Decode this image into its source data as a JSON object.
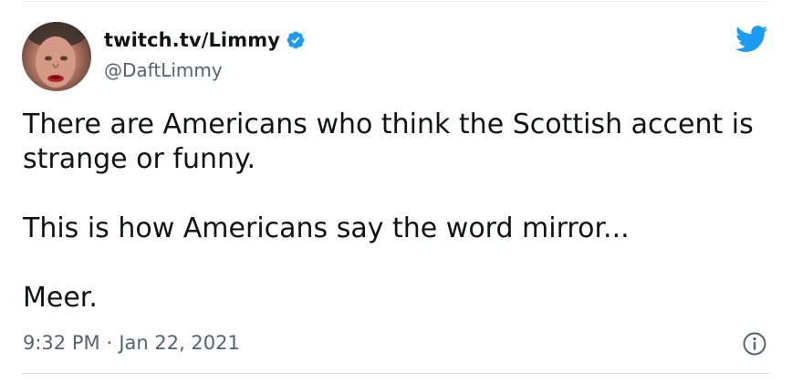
{
  "author": {
    "display_name": "twitch.tv/Limmy",
    "handle": "@DaftLimmy",
    "avatar_icon": "user-avatar",
    "verified_icon": "verified-badge-icon"
  },
  "tweet": {
    "paragraphs": [
      "There are Americans who think the Scottish accent is strange or funny.",
      "This is how Americans say the word mirror...",
      "Meer."
    ],
    "time": "9:32 PM",
    "separator": "·",
    "date": "Jan 22, 2021"
  },
  "icons": {
    "brand": "twitter-bird-icon",
    "info": "info-icon"
  },
  "colors": {
    "twitter_blue": "#1d9bf0",
    "text": "#0f1419",
    "muted": "#536471"
  }
}
